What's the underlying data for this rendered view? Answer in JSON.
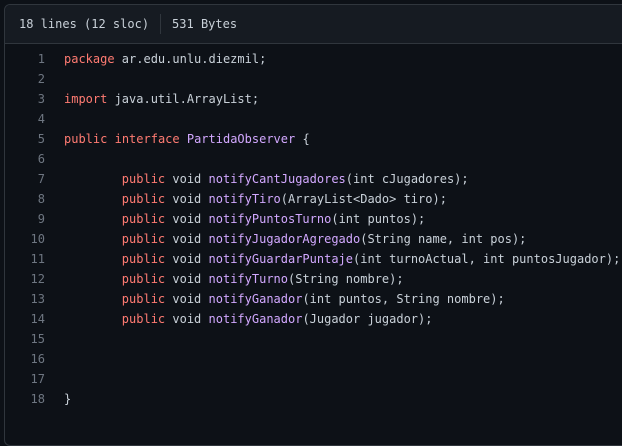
{
  "header": {
    "lines_info": "18 lines (12 sloc)",
    "size": "531 Bytes"
  },
  "colors": {
    "keyword": "#ff7b72",
    "entity": "#d2a8ff",
    "text": "#c9d1d9",
    "line_number": "#6e7681",
    "background": "#0d1117"
  },
  "code": {
    "lines": [
      {
        "n": "1",
        "tokens": [
          {
            "t": "package",
            "c": "kw"
          },
          {
            "t": " ar.edu.unlu.diezmil;",
            "c": ""
          }
        ]
      },
      {
        "n": "2",
        "tokens": []
      },
      {
        "n": "3",
        "tokens": [
          {
            "t": "import",
            "c": "kw"
          },
          {
            "t": " java.util.ArrayList;",
            "c": ""
          }
        ]
      },
      {
        "n": "4",
        "tokens": []
      },
      {
        "n": "5",
        "tokens": [
          {
            "t": "public",
            "c": "kw"
          },
          {
            "t": " ",
            "c": ""
          },
          {
            "t": "interface",
            "c": "kw"
          },
          {
            "t": " ",
            "c": ""
          },
          {
            "t": "PartidaObserver",
            "c": "ent"
          },
          {
            "t": " {",
            "c": ""
          }
        ]
      },
      {
        "n": "6",
        "tokens": []
      },
      {
        "n": "7",
        "tokens": [
          {
            "t": "        ",
            "c": ""
          },
          {
            "t": "public",
            "c": "kw"
          },
          {
            "t": " void ",
            "c": ""
          },
          {
            "t": "notifyCantJugadores",
            "c": "ent"
          },
          {
            "t": "(int cJugadores);",
            "c": ""
          }
        ]
      },
      {
        "n": "8",
        "tokens": [
          {
            "t": "        ",
            "c": ""
          },
          {
            "t": "public",
            "c": "kw"
          },
          {
            "t": " void ",
            "c": ""
          },
          {
            "t": "notifyTiro",
            "c": "ent"
          },
          {
            "t": "(ArrayList<Dado> tiro);",
            "c": ""
          }
        ]
      },
      {
        "n": "9",
        "tokens": [
          {
            "t": "        ",
            "c": ""
          },
          {
            "t": "public",
            "c": "kw"
          },
          {
            "t": " void ",
            "c": ""
          },
          {
            "t": "notifyPuntosTurno",
            "c": "ent"
          },
          {
            "t": "(int puntos);",
            "c": ""
          }
        ]
      },
      {
        "n": "10",
        "tokens": [
          {
            "t": "        ",
            "c": ""
          },
          {
            "t": "public",
            "c": "kw"
          },
          {
            "t": " void ",
            "c": ""
          },
          {
            "t": "notifyJugadorAgregado",
            "c": "ent"
          },
          {
            "t": "(String name, int pos);",
            "c": ""
          }
        ]
      },
      {
        "n": "11",
        "tokens": [
          {
            "t": "        ",
            "c": ""
          },
          {
            "t": "public",
            "c": "kw"
          },
          {
            "t": " void ",
            "c": ""
          },
          {
            "t": "notifyGuardarPuntaje",
            "c": "ent"
          },
          {
            "t": "(int turnoActual, int puntosJugador);",
            "c": ""
          }
        ]
      },
      {
        "n": "12",
        "tokens": [
          {
            "t": "        ",
            "c": ""
          },
          {
            "t": "public",
            "c": "kw"
          },
          {
            "t": " void ",
            "c": ""
          },
          {
            "t": "notifyTurno",
            "c": "ent"
          },
          {
            "t": "(String nombre);",
            "c": ""
          }
        ]
      },
      {
        "n": "13",
        "tokens": [
          {
            "t": "        ",
            "c": ""
          },
          {
            "t": "public",
            "c": "kw"
          },
          {
            "t": " void ",
            "c": ""
          },
          {
            "t": "notifyGanador",
            "c": "ent"
          },
          {
            "t": "(int puntos, String nombre);",
            "c": ""
          }
        ]
      },
      {
        "n": "14",
        "tokens": [
          {
            "t": "        ",
            "c": ""
          },
          {
            "t": "public",
            "c": "kw"
          },
          {
            "t": " void ",
            "c": ""
          },
          {
            "t": "notifyGanador",
            "c": "ent"
          },
          {
            "t": "(Jugador jugador);",
            "c": ""
          }
        ]
      },
      {
        "n": "15",
        "tokens": []
      },
      {
        "n": "16",
        "tokens": []
      },
      {
        "n": "17",
        "tokens": []
      },
      {
        "n": "18",
        "tokens": [
          {
            "t": "}",
            "c": ""
          }
        ]
      }
    ]
  }
}
